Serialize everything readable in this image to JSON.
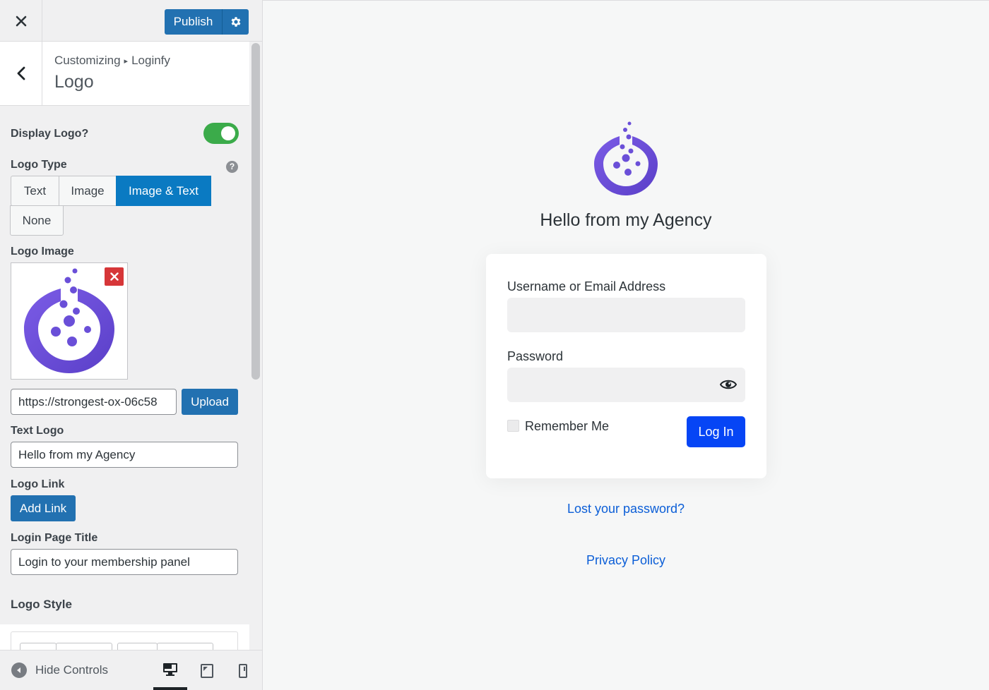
{
  "sidebar": {
    "publish_label": "Publish",
    "breadcrumb_root": "Customizing",
    "breadcrumb_separator": "▸",
    "breadcrumb_parent": "Loginfy",
    "section_title": "Logo",
    "display_logo": {
      "label": "Display Logo?",
      "enabled": true
    },
    "logo_type": {
      "label": "Logo Type",
      "help": "?",
      "options": [
        "Text",
        "Image",
        "Image & Text",
        "None"
      ],
      "selected": "Image & Text"
    },
    "logo_image": {
      "label": "Logo Image",
      "url_value": "https://strongest-ox-06c58",
      "upload_label": "Upload"
    },
    "text_logo": {
      "label": "Text Logo",
      "value": "Hello from my Agency"
    },
    "logo_link": {
      "label": "Logo Link",
      "button_label": "Add Link"
    },
    "login_page_title": {
      "label": "Login Page Title",
      "value": "Login to your membership panel"
    },
    "logo_style_label": "Logo Style",
    "footer": {
      "hide_controls_label": "Hide Controls",
      "active_device": "desktop"
    }
  },
  "preview": {
    "site_title": "Hello from my Agency",
    "username_label": "Username or Email Address",
    "password_label": "Password",
    "remember_label": "Remember Me",
    "login_button": "Log In",
    "lost_password": "Lost your password?",
    "privacy_policy": "Privacy Policy"
  },
  "colors": {
    "primary_button": "#2271b1",
    "segment_active": "#0a7ac2",
    "toggle_on": "#3bab4a",
    "remove_red": "#d63638",
    "login_button": "#0645f5",
    "link": "#0b5ed7",
    "logo_purple": "#6a4fd8"
  },
  "icons": [
    "close-icon",
    "gear-icon",
    "chevron-left-icon",
    "help-icon",
    "remove-icon",
    "eye-icon",
    "arrow-left-circle-icon",
    "desktop-icon",
    "tablet-icon",
    "mobile-icon",
    "logo-icon"
  ]
}
